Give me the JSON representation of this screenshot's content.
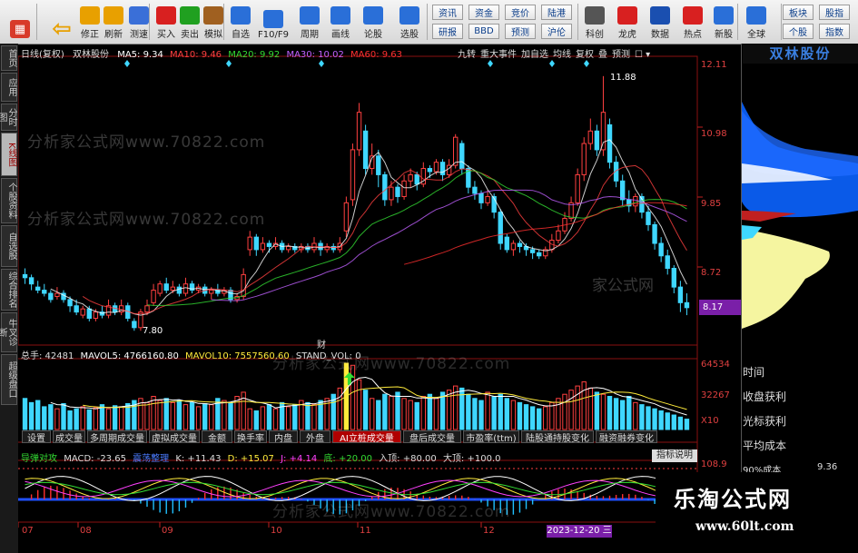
{
  "toolbar": {
    "buttons": [
      {
        "label": "",
        "icon": "grid-icon"
      },
      {
        "label": "",
        "icon": "back-arrow-icon"
      },
      {
        "label": "修正",
        "icon": "up-arrow-icon"
      },
      {
        "label": "刷新",
        "icon": "refresh-icon"
      },
      {
        "label": "测速",
        "icon": "clock-icon"
      },
      {
        "label": "买入",
        "icon": "buy-icon"
      },
      {
        "label": "卖出",
        "icon": "sell-icon"
      },
      {
        "label": "模拟",
        "icon": "hammer-icon"
      },
      {
        "label": "自选",
        "icon": "watchlist-icon"
      },
      {
        "label": "F10/F9",
        "icon": "f10-icon"
      },
      {
        "label": "周期",
        "icon": "period-icon"
      },
      {
        "label": "画线",
        "icon": "pen-icon"
      },
      {
        "label": "论股",
        "icon": "discuss-icon"
      },
      {
        "label": "选股",
        "icon": "screener-icon"
      },
      {
        "label": "科创",
        "icon": "star-market-icon"
      },
      {
        "label": "龙虎",
        "icon": "dragon-tiger-icon"
      },
      {
        "label": "数据",
        "icon": "data-icon"
      },
      {
        "label": "热点",
        "icon": "hotspot-icon"
      },
      {
        "label": "新股",
        "icon": "ipo-icon"
      },
      {
        "label": "全球",
        "icon": "globe-icon"
      }
    ],
    "small_buttons": [
      "资讯",
      "资金",
      "竞价",
      "陆港",
      "研报",
      "BBD",
      "预测",
      "沪伦",
      "板块",
      "股指",
      "个股",
      "指数"
    ]
  },
  "left_tabs": [
    "首页",
    "应用",
    "分时图",
    "K线图",
    "个股资料",
    "自选股",
    "综合排名",
    "牛叉诊断",
    "超级盘口"
  ],
  "chart_header": {
    "period": "日线(复权)",
    "stock_name": "双林股份",
    "ma5": "MA5: 9.34",
    "ma10": "MA10: 9.46",
    "ma20": "MA20: 9.92",
    "ma30": "MA30: 10.02",
    "ma60": "MA60: 9.63",
    "right_tools": [
      "九转",
      "重大事件",
      "加自选",
      "均线",
      "复权",
      "叠",
      "预测"
    ]
  },
  "watermarks": [
    "分析家公式网www.70822.com",
    "分析家公式网www.70822.com",
    "分析家公式网www.70822.com",
    "分析家公式网www.70822.com",
    "家公式网",
    "乐淘公式网",
    "www.60lt.com"
  ],
  "price_axis": {
    "labels": [
      "12.11",
      "10.98",
      "9.85",
      "8.72",
      "8.17"
    ],
    "current": "8.17"
  },
  "price_marks": {
    "high": "11.88",
    "low": "7.80",
    "event": "财"
  },
  "volume_header": {
    "total": "总手: 42481",
    "mavol5": "MAVOL5: 4766160.80",
    "mavol10": "MAVOL10: 7557560.60",
    "stand": "STAND_VOL: 0"
  },
  "volume_axis": {
    "labels": [
      "64534",
      "32267",
      "X10"
    ]
  },
  "sub_tabs": [
    "设置",
    "成交量",
    "多周期成交量",
    "虚拟成交量",
    "金额",
    "换手率",
    "内盘",
    "外盘",
    "AI立桩成交量",
    "盘后成交量",
    "市盈率(ttm)",
    "陆股通持股变化",
    "融资融券变化"
  ],
  "active_sub_tab": "AI立桩成交量",
  "indicator_header": {
    "name": "导弹对攻",
    "macd": "MACD: -23.65",
    "tag": "震荡整理",
    "k": "K: +11.43",
    "d": "D: +15.07",
    "j": "J: +4.14",
    "bottom": "底: +20.00",
    "entry": "入顶: +80.00",
    "top": "大顶: +100.0",
    "help": "指标说明"
  },
  "indicator_axis": {
    "label": "108.9"
  },
  "date_axis": {
    "labels": [
      "07",
      "08",
      "09",
      "10",
      "11",
      "12"
    ],
    "selected": "2023-12-20 三"
  },
  "right_panel": {
    "title": "双林股份",
    "items": [
      "时间",
      "收盘获利",
      "光标获利",
      "平均成本",
      "90%成本"
    ],
    "cost_value": "9.36"
  },
  "chart_data": {
    "type": "candlestick",
    "title": "双林股份",
    "ylim": [
      7.6,
      12.11
    ],
    "candles": [
      [
        8.7,
        8.65,
        8.8,
        8.55
      ],
      [
        8.65,
        8.55,
        8.7,
        8.45
      ],
      [
        8.5,
        8.45,
        8.6,
        8.4
      ],
      [
        8.45,
        8.4,
        8.55,
        8.35
      ],
      [
        8.4,
        8.3,
        8.45,
        8.25
      ],
      [
        8.35,
        8.4,
        8.5,
        8.3
      ],
      [
        8.4,
        8.3,
        8.45,
        8.25
      ],
      [
        8.3,
        8.2,
        8.35,
        8.1
      ],
      [
        8.2,
        8.1,
        8.3,
        8.05
      ],
      [
        8.05,
        8.15,
        8.2,
        8.0
      ],
      [
        8.15,
        8.0,
        8.2,
        7.95
      ],
      [
        8.0,
        8.1,
        8.15,
        7.95
      ],
      [
        8.1,
        8.05,
        8.2,
        8.0
      ],
      [
        8.05,
        8.2,
        8.3,
        8.0
      ],
      [
        8.2,
        8.1,
        8.25,
        8.05
      ],
      [
        8.1,
        8.2,
        8.3,
        8.05
      ],
      [
        8.2,
        8.0,
        8.25,
        7.95
      ],
      [
        7.95,
        7.85,
        8.0,
        7.8
      ],
      [
        7.85,
        8.1,
        8.15,
        7.8
      ],
      [
        8.1,
        8.2,
        8.3,
        8.05
      ],
      [
        8.25,
        8.45,
        8.55,
        8.2
      ],
      [
        8.4,
        8.55,
        8.6,
        8.35
      ],
      [
        8.55,
        8.45,
        8.65,
        8.4
      ],
      [
        8.45,
        8.5,
        8.6,
        8.4
      ],
      [
        8.5,
        8.4,
        8.55,
        8.35
      ],
      [
        8.4,
        8.55,
        8.65,
        8.35
      ],
      [
        8.55,
        8.45,
        8.6,
        8.4
      ],
      [
        8.45,
        8.5,
        8.55,
        8.4
      ],
      [
        8.5,
        8.4,
        8.55,
        8.35
      ],
      [
        8.4,
        8.45,
        8.5,
        8.3
      ],
      [
        8.45,
        8.4,
        8.55,
        8.35
      ],
      [
        8.4,
        8.45,
        8.5,
        8.35
      ],
      [
        8.45,
        8.3,
        8.5,
        8.25
      ],
      [
        8.3,
        8.35,
        8.4,
        8.25
      ],
      [
        8.35,
        8.7,
        8.8,
        8.3
      ],
      [
        9.1,
        9.3,
        9.4,
        9.0
      ],
      [
        9.3,
        9.1,
        9.35,
        9.0
      ],
      [
        9.1,
        9.2,
        9.3,
        9.05
      ],
      [
        9.2,
        9.15,
        9.25,
        9.05
      ],
      [
        9.15,
        9.2,
        9.3,
        9.1
      ],
      [
        9.2,
        9.1,
        9.25,
        9.05
      ],
      [
        9.1,
        9.15,
        9.2,
        9.05
      ],
      [
        9.15,
        9.1,
        9.2,
        9.05
      ],
      [
        9.1,
        9.15,
        9.2,
        9.05
      ],
      [
        9.15,
        9.1,
        9.2,
        9.05
      ],
      [
        9.1,
        9.2,
        9.3,
        9.05
      ],
      [
        9.2,
        9.1,
        9.25,
        9.0
      ],
      [
        9.1,
        9.15,
        9.2,
        9.05
      ],
      [
        9.15,
        9.1,
        9.2,
        9.05
      ],
      [
        9.1,
        9.2,
        9.3,
        9.05
      ],
      [
        9.4,
        9.85,
        9.95,
        9.3
      ],
      [
        9.9,
        10.7,
        10.8,
        9.8
      ],
      [
        10.7,
        11.3,
        11.45,
        10.6
      ],
      [
        11.0,
        10.4,
        11.1,
        10.3
      ],
      [
        10.4,
        10.6,
        10.8,
        10.3
      ],
      [
        10.6,
        10.3,
        10.7,
        10.1
      ],
      [
        10.3,
        9.9,
        10.35,
        9.8
      ],
      [
        9.9,
        10.1,
        10.2,
        9.8
      ],
      [
        10.1,
        9.95,
        10.15,
        9.85
      ],
      [
        9.95,
        10.2,
        10.3,
        9.9
      ],
      [
        10.2,
        10.3,
        10.4,
        10.1
      ],
      [
        10.3,
        10.15,
        10.35,
        10.05
      ],
      [
        10.15,
        10.4,
        10.5,
        10.1
      ],
      [
        10.4,
        10.35,
        10.45,
        10.25
      ],
      [
        10.35,
        10.5,
        10.55,
        10.3
      ],
      [
        10.5,
        10.3,
        10.55,
        10.2
      ],
      [
        10.3,
        10.45,
        10.55,
        10.25
      ],
      [
        10.45,
        10.9,
        10.95,
        10.4
      ],
      [
        10.8,
        10.4,
        10.85,
        10.3
      ],
      [
        10.4,
        10.1,
        10.45,
        10.0
      ],
      [
        10.1,
        10.0,
        10.2,
        9.9
      ],
      [
        10.0,
        9.85,
        10.05,
        9.75
      ],
      [
        9.85,
        9.95,
        10.05,
        9.8
      ],
      [
        9.95,
        9.7,
        10.0,
        9.6
      ],
      [
        9.7,
        9.2,
        9.75,
        9.1
      ],
      [
        9.3,
        9.1,
        9.35,
        9.05
      ],
      [
        9.1,
        9.2,
        9.25,
        9.0
      ],
      [
        9.2,
        9.15,
        9.25,
        9.05
      ],
      [
        9.15,
        9.1,
        9.2,
        9.0
      ],
      [
        9.1,
        9.05,
        9.15,
        8.95
      ],
      [
        9.05,
        9.0,
        9.1,
        8.95
      ],
      [
        9.0,
        9.1,
        9.15,
        8.95
      ],
      [
        9.1,
        9.25,
        9.35,
        9.05
      ],
      [
        9.25,
        9.4,
        9.5,
        9.2
      ],
      [
        9.4,
        9.6,
        9.7,
        9.35
      ],
      [
        9.6,
        9.85,
        9.95,
        9.55
      ],
      [
        9.85,
        10.3,
        10.4,
        9.8
      ],
      [
        10.3,
        10.8,
        10.9,
        10.2
      ],
      [
        10.8,
        11.0,
        11.2,
        10.7
      ],
      [
        11.0,
        10.7,
        11.1,
        10.6
      ],
      [
        10.7,
        11.3,
        11.88,
        10.6
      ],
      [
        11.1,
        10.5,
        11.2,
        10.4
      ],
      [
        10.5,
        10.2,
        10.6,
        10.1
      ],
      [
        10.2,
        9.9,
        10.3,
        9.8
      ],
      [
        9.9,
        9.8,
        10.05,
        9.7
      ],
      [
        9.8,
        9.95,
        10.0,
        9.7
      ],
      [
        9.95,
        9.7,
        10.0,
        9.6
      ],
      [
        9.7,
        9.5,
        9.8,
        9.4
      ],
      [
        9.5,
        9.2,
        9.55,
        9.1
      ],
      [
        9.2,
        9.0,
        9.3,
        8.9
      ],
      [
        9.0,
        8.8,
        9.1,
        8.7
      ],
      [
        8.8,
        8.5,
        8.85,
        8.4
      ],
      [
        8.5,
        8.25,
        8.6,
        8.1
      ],
      [
        8.25,
        8.17,
        8.4,
        8.05
      ]
    ],
    "volumes": [
      30,
      26,
      28,
      22,
      24,
      20,
      25,
      18,
      20,
      22,
      19,
      21,
      24,
      20,
      23,
      22,
      25,
      28,
      30,
      26,
      32,
      28,
      30,
      26,
      28,
      24,
      26,
      22,
      25,
      24,
      30,
      28,
      26,
      32,
      36,
      20,
      18,
      22,
      24,
      20,
      26,
      22,
      24,
      28,
      26,
      24,
      28,
      30,
      34,
      40,
      64,
      62,
      48,
      38,
      30,
      28,
      34,
      32,
      36,
      30,
      28,
      26,
      32,
      34,
      30,
      36,
      38,
      42,
      40,
      34,
      30,
      28,
      36,
      32,
      34,
      30,
      28,
      26,
      24,
      22,
      20,
      22,
      26,
      30,
      34,
      38,
      42,
      46,
      40,
      36,
      34,
      32,
      30,
      28,
      32,
      26,
      24,
      22,
      20,
      18,
      16,
      14,
      12,
      10
    ]
  }
}
